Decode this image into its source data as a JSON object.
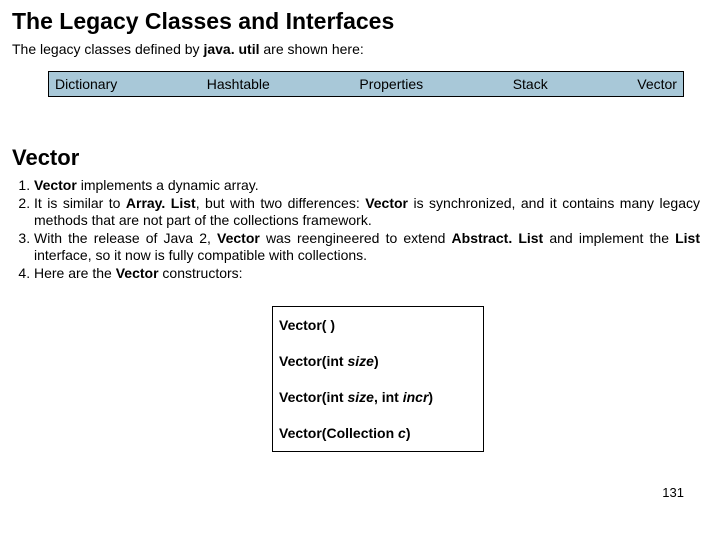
{
  "title": "The Legacy Classes and Interfaces",
  "intro": {
    "prefix": "The legacy classes defined by ",
    "pkg": "java. util",
    "suffix": " are shown here:"
  },
  "legacy": [
    "Dictionary",
    "Hashtable",
    "Properties",
    "Stack",
    "Vector"
  ],
  "section": "Vector",
  "notes": {
    "n1": {
      "a": "Vector",
      "b": " implements a dynamic array."
    },
    "n2": {
      "a": "It is similar to ",
      "b": "Array. List",
      "c": ", but with two differences: ",
      "d": "Vector",
      "e": " is synchronized, and it contains many legacy methods that are not part of the collections framework."
    },
    "n3": {
      "a": "With the release of Java 2, ",
      "b": "Vector",
      "c": " was reengineered to extend ",
      "d": "Abstract. List",
      "e": " and implement the ",
      "f": "List",
      "g": " interface, so it now is fully compatible with collections."
    },
    "n4": {
      "a": "Here are the ",
      "b": "Vector",
      "c": " constructors:"
    }
  },
  "constructors": {
    "c1": {
      "sig": "Vector( )"
    },
    "c2": {
      "a": "Vector(int ",
      "p1": "size",
      "b": ")"
    },
    "c3": {
      "a": "Vector(int ",
      "p1": "size",
      "b": ", int ",
      "p2": "incr",
      "c": ")"
    },
    "c4": {
      "a": "Vector(Collection ",
      "p1": "c",
      "b": ")"
    }
  },
  "page_number": "131"
}
